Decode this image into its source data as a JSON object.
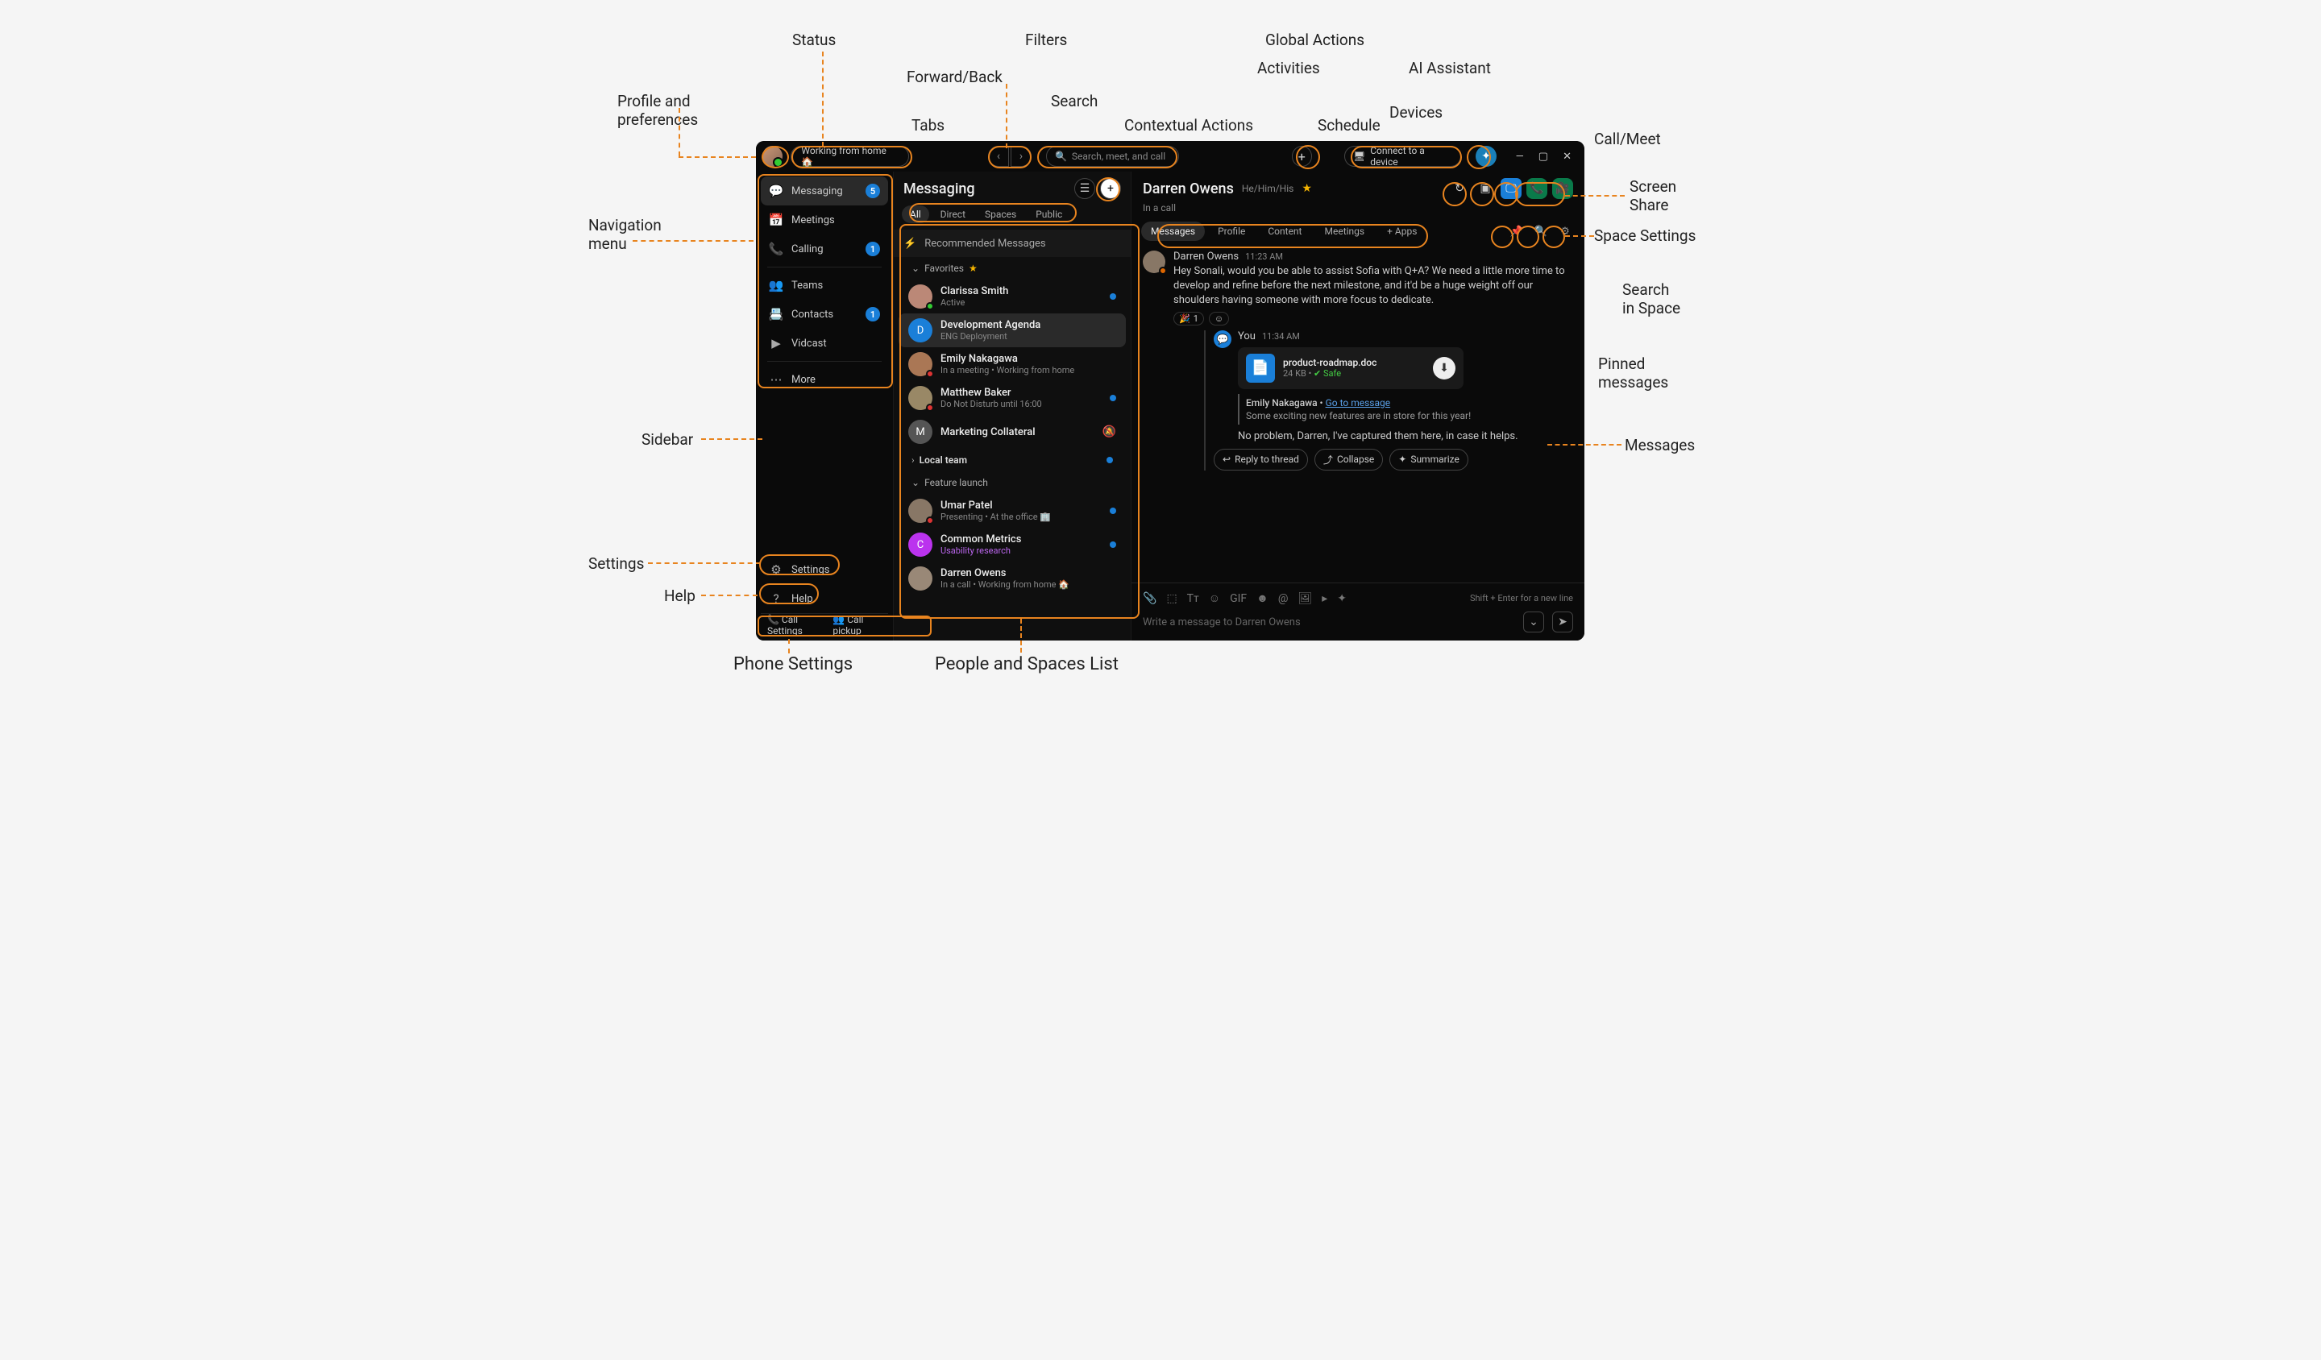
{
  "annotations": {
    "profile": "Profile and\npreferences",
    "status": "Status",
    "fwdback": "Forward/Back",
    "tabs_label": "Tabs",
    "search_label": "Search",
    "filters": "Filters",
    "contextual": "Contextual Actions",
    "activities": "Activities",
    "global": "Global Actions",
    "schedule": "Schedule",
    "devices": "Devices",
    "ai": "AI Assistant",
    "callmeet": "Call/Meet",
    "screenshare": "Screen\nShare",
    "spacesettings": "Space Settings",
    "searchspace": "Search\nin Space",
    "pinned": "Pinned\nmessages",
    "messages_label": "Messages",
    "navmenu": "Navigation\nmenu",
    "sidebar_label": "Sidebar",
    "settings_label": "Settings",
    "help_label": "Help",
    "phone_label": "Phone Settings",
    "people_label": "People and Spaces List"
  },
  "topbar": {
    "status_text": "Working from home 🏠",
    "search_placeholder": "Search, meet, and call",
    "device_label": "Connect to a device"
  },
  "nav": [
    {
      "icon": "💬",
      "label": "Messaging",
      "badge": "5",
      "active": true
    },
    {
      "icon": "📅",
      "label": "Meetings"
    },
    {
      "icon": "📞",
      "label": "Calling",
      "badge": "1"
    },
    {
      "div": true
    },
    {
      "icon": "👥",
      "label": "Teams"
    },
    {
      "icon": "📇",
      "label": "Contacts",
      "badge": "1"
    },
    {
      "icon": "▶",
      "label": "Vidcast"
    },
    {
      "div": true
    },
    {
      "icon": "⋯",
      "label": "More"
    }
  ],
  "sidebar_bottom": {
    "settings": "Settings",
    "help": "Help"
  },
  "phone_bar": {
    "call_settings": "Call Settings",
    "call_pickup": "Call pickup"
  },
  "list": {
    "title": "Messaging",
    "tabs": [
      "All",
      "Direct",
      "Spaces",
      "Public"
    ],
    "recommended": "Recommended Messages",
    "fav_header": "Favorites",
    "sections": [
      {
        "name": "Local team",
        "collapsed": true,
        "unread": true
      },
      {
        "name": "Feature launch",
        "collapsed": false
      }
    ],
    "favorites": [
      {
        "name": "Clarissa Smith",
        "sub": "Active",
        "color": "#b87",
        "unread": true,
        "badge_color": "#3c3"
      },
      {
        "name": "Development Agenda",
        "sub": "ENG Deployment",
        "color": "#1a7fd8",
        "letter": "D",
        "active": true
      },
      {
        "name": "Emily Nakagawa",
        "sub": "In a meeting  •  Working from home",
        "color": "#a75",
        "badge_color": "#d33"
      },
      {
        "name": "Matthew Baker",
        "sub": "Do Not Disturb until 16:00",
        "color": "#986",
        "unread": true,
        "badge_color": "#d33"
      },
      {
        "name": "Marketing Collateral",
        "sub": "",
        "color": "#555",
        "letter": "M",
        "muted": true
      }
    ],
    "launch": [
      {
        "name": "Umar Patel",
        "sub": "Presenting  •  At the office 🏢",
        "color": "#876",
        "unread": true,
        "badge_color": "#d33"
      },
      {
        "name": "Common Metrics",
        "sub": "Usability research",
        "sub_color": "#b6e",
        "color": "#b3e",
        "letter": "C",
        "unread": true
      },
      {
        "name": "Darren Owens",
        "sub": "In a call  •  Working from home 🏠",
        "color": "#987"
      }
    ]
  },
  "chat": {
    "name": "Darren Owens",
    "pronouns": "He/Him/His",
    "status": "In a call",
    "tabs": [
      "Messages",
      "Profile",
      "Content",
      "Meetings"
    ],
    "apps": "Apps",
    "msg1": {
      "author": "Darren Owens",
      "time": "11:23 AM",
      "text": "Hey Sonali, would you be able to assist Sofia with Q+A? We need a little more time to develop and refine before the next milestone, and it'd be a huge weight off our shoulders having someone with more focus to dedicate.",
      "reaction_emoji": "🎉",
      "reaction_count": "1"
    },
    "reply": {
      "author": "You",
      "time": "11:34 AM",
      "file": {
        "name": "product-roadmap.doc",
        "size": "24 KB",
        "safe": "Safe"
      },
      "quote_author": "Emily Nakagawa",
      "quote_link": "Go to message",
      "quote_text": "Some exciting new features are in store for this year!",
      "text": "No problem, Darren, I've captured them here, in case it helps."
    },
    "thread_actions": {
      "reply": "Reply to thread",
      "collapse": "Collapse",
      "summarize": "Summarize"
    },
    "composer": {
      "hint": "Shift + Enter for a new line",
      "placeholder": "Write a message to Darren Owens"
    }
  }
}
